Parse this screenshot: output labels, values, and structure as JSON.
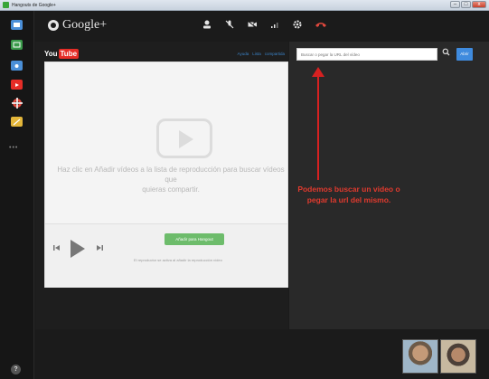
{
  "window": {
    "title": "Hangouts de Google+",
    "buttons": [
      "–",
      "□",
      "x"
    ]
  },
  "rail": {
    "items": [
      "chat",
      "screenshare",
      "capture",
      "youtube",
      "help-ring",
      "sketchpad"
    ],
    "more_label": "•••",
    "help_label": "?"
  },
  "topbar": {
    "brand": "Google+",
    "controls": [
      "invite",
      "mute-mic",
      "video-off",
      "bandwidth",
      "settings",
      "hang-up"
    ]
  },
  "youtube": {
    "logo_you": "You",
    "logo_tube": "Tube",
    "links": [
      "Ayuda",
      "Lista",
      "compartida"
    ],
    "empty_message": "Haz clic en Añadir vídeos a la lista de reproducción para buscar vídeos que\nquieras compartir.",
    "add_button": "Añadir para Hangout",
    "player_note": "El reproductor se activa al añadir la reproducción vídeo"
  },
  "search": {
    "placeholder": "Buscar o pegar la URL del vídeo",
    "open_label": "Abrir"
  },
  "annotation": {
    "text": "Podemos buscar un video o\npegar la url del mismo."
  },
  "colors": {
    "accent_blue": "#3f8bde",
    "youtube_red": "#e52d27",
    "add_green": "#6dbc6b",
    "annotation_red": "#d62121"
  }
}
